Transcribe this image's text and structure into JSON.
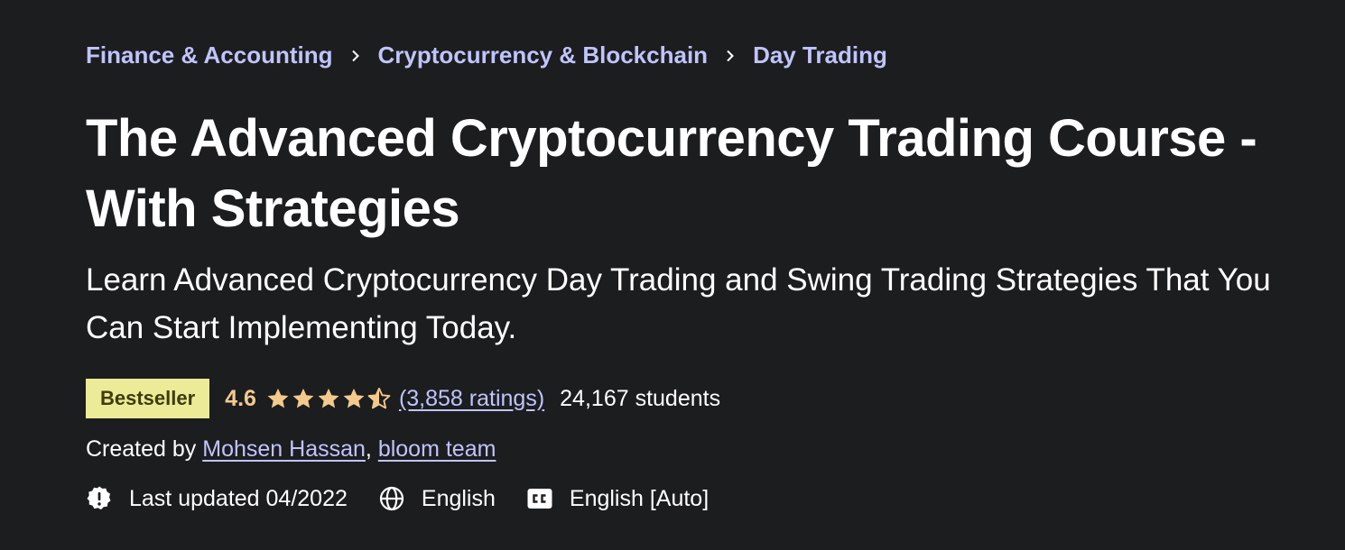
{
  "breadcrumb": [
    {
      "label": "Finance & Accounting"
    },
    {
      "label": "Cryptocurrency & Blockchain"
    },
    {
      "label": "Day Trading"
    }
  ],
  "course": {
    "title": "The Advanced Cryptocurrency Trading Course - With Strategies",
    "subtitle": "Learn Advanced Cryptocurrency Day Trading and Swing Trading Strategies That You Can Start Implementing Today."
  },
  "meta": {
    "badge": "Bestseller",
    "rating": "4.6",
    "rating_value": 4.6,
    "ratings_count": "(3,858 ratings)",
    "students": "24,167 students"
  },
  "created": {
    "prefix": "Created by",
    "authors": [
      "Mohsen Hassan",
      "bloom team"
    ],
    "separator": ","
  },
  "info": {
    "last_updated": "Last updated 04/2022",
    "language": "English",
    "captions": "English [Auto]"
  },
  "icons": {
    "breadcrumb_separator": "chevron-right-icon",
    "last_updated": "alert-badge-icon",
    "language": "globe-icon",
    "captions": "closed-captions-icon"
  },
  "colors": {
    "background": "#1c1d1f",
    "link": "#c0c4fc",
    "badge_bg": "#eceb98",
    "badge_text": "#3d3c0a",
    "star": "#f3ca8c"
  }
}
